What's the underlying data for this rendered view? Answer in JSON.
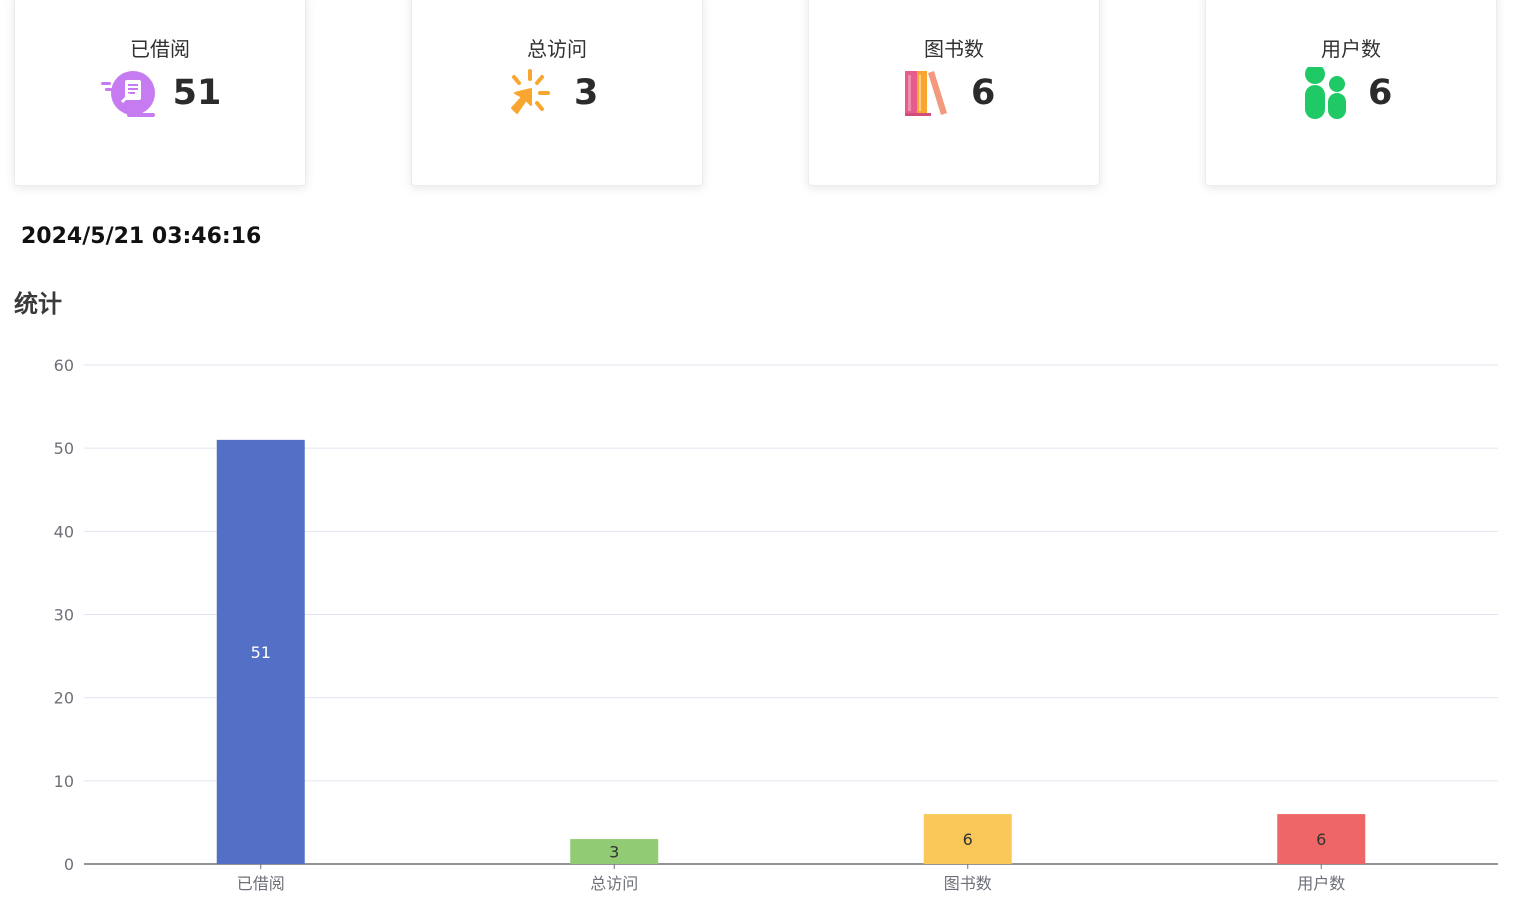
{
  "stats": [
    {
      "title": "已借阅",
      "value": "51",
      "icon": "borrow-book-icon",
      "color": "#c77bf0"
    },
    {
      "title": "总访问",
      "value": "3",
      "icon": "click-cursor-icon",
      "color": "#f9a630"
    },
    {
      "title": "图书数",
      "value": "6",
      "icon": "books-icon",
      "color": "#e45d8c"
    },
    {
      "title": "用户数",
      "value": "6",
      "icon": "users-icon",
      "color": "#1fc965"
    }
  ],
  "datetime": "2024/5/21 03:46:16",
  "section_title": "统计",
  "chart_data": {
    "type": "bar",
    "categories": [
      "已借阅",
      "总访问",
      "图书数",
      "用户数"
    ],
    "values": [
      51,
      3,
      6,
      6
    ],
    "colors": [
      "#5470c6",
      "#91cc75",
      "#fac858",
      "#ee6666"
    ],
    "label_colors": [
      "#ffffff",
      "#333333",
      "#333333",
      "#333333"
    ],
    "ylim": [
      0,
      60
    ],
    "yticks": [
      0,
      10,
      20,
      30,
      40,
      50,
      60
    ],
    "grid": true,
    "title": "",
    "xlabel": "",
    "ylabel": ""
  }
}
